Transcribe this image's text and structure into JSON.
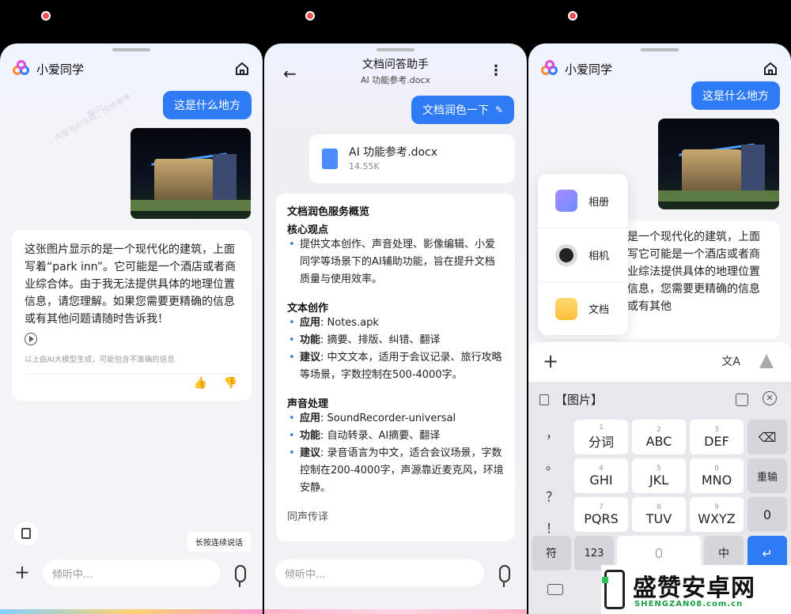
{
  "panel1": {
    "title": "小爱同学",
    "user_msg": "这是什么地方",
    "answer": "这张图片显示的是一个现代化的建筑，上面写着“park inn”。它可能是一个酒店或者商业综合体。由于我无法提供具体的地理位置信息，请您理解。如果您需要更精确的信息或有其他问题请随时告诉我！",
    "disclaimer": "以上由AI大模型生成，可能包含不准确的信息",
    "tooltip": "长按连续说话",
    "input_placeholder": "倾听中...",
    "watermark": "内容为AI生成，仅供参考",
    "watermark_id": "Rcjz"
  },
  "panel2": {
    "title": "文档问答助手",
    "subtitle": "AI 功能参考.docx",
    "user_msg": "文档润色一下",
    "file_name": "AI 功能参考.docx",
    "file_size": "14.55K",
    "heading": "文档润色服务概览",
    "core_title": "核心观点",
    "core_text": "提供文本创作、声音处理、影像编辑、小爱同学等场景下的AI辅助功能，旨在提升文档质量与使用效率。",
    "s1_title": "文本创作",
    "s1_app_k": "应用",
    "s1_app_v": ": Notes.apk",
    "s1_fn_k": "功能",
    "s1_fn_v": ": 摘要、排版、纠错、翻译",
    "s1_sg_k": "建议",
    "s1_sg_v": ": 中文文本，适用于会议记录、旅行攻略等场景，字数控制在500-4000字。",
    "s2_title": "声音处理",
    "s2_app_k": "应用",
    "s2_app_v": ": SoundRecorder-universal",
    "s2_fn_k": "功能",
    "s2_fn_v": ": 自动转录、AI摘要、翻译",
    "s2_sg_k": "建议",
    "s2_sg_v": ": 录音语言为中文，适合会议场景，字数控制在200-4000字，声源靠近麦克风，环境安静。",
    "s3_title": "同声传译",
    "input_placeholder": "倾听中..."
  },
  "panel3": {
    "title": "小爱同学",
    "user_msg": "这是什么地方",
    "answer": "是一个现代化的建筑，上面写它可能是一个酒店或者商业综法提供具体的地理位置信息，您需要更精确的信息或有其他",
    "menu": [
      "相册",
      "相机",
      "文档"
    ],
    "kb_bar_text": "【图片】",
    "keys": [
      {
        "n": "1",
        "l": "分词"
      },
      {
        "n": "2",
        "l": "ABC"
      },
      {
        "n": "3",
        "l": "DEF"
      },
      {
        "n": "4",
        "l": "GHI"
      },
      {
        "n": "5",
        "l": "JKL"
      },
      {
        "n": "6",
        "l": "MNO"
      },
      {
        "n": "7",
        "l": "PQRS"
      },
      {
        "n": "8",
        "l": "TUV"
      },
      {
        "n": "9",
        "l": "WXYZ"
      }
    ],
    "side_syms": [
      "，",
      "。",
      "？",
      "！"
    ],
    "reenter": "重输",
    "zero": "0",
    "fu": "符",
    "num": "123",
    "zh": "中",
    "brand_text": "盛赞安卓网",
    "brand_url": "SHENGZAN08.com.cn"
  }
}
